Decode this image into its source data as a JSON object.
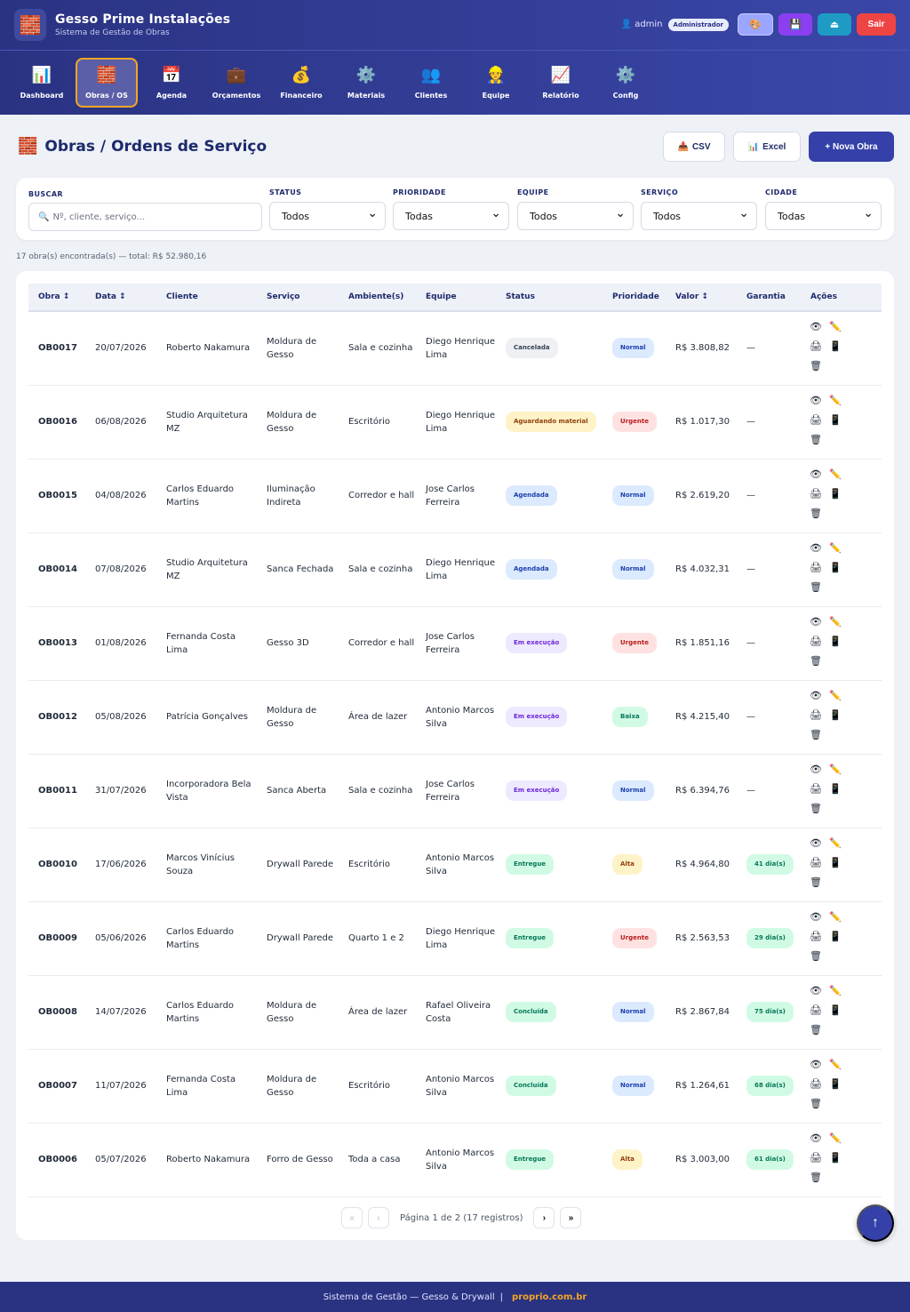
{
  "app": {
    "title": "Gesso Prime Instalações",
    "subtitle": "Sistema de Gestão de Obras",
    "logo_icon": "brick-icon"
  },
  "user": {
    "name": "admin",
    "role": "Administrador"
  },
  "header_buttons": [
    {
      "icon": "palette-icon",
      "glyph": "🎨"
    },
    {
      "icon": "save-icon",
      "glyph": "💾"
    },
    {
      "icon": "upload-icon",
      "glyph": "⏏"
    },
    {
      "label": "Sair"
    }
  ],
  "nav": [
    {
      "label": "Dashboard",
      "glyph": "📊",
      "icon": "chart-icon"
    },
    {
      "label": "Obras / OS",
      "glyph": "🧱",
      "icon": "brick-icon",
      "active": true
    },
    {
      "label": "Agenda",
      "glyph": "📅",
      "icon": "calendar-icon"
    },
    {
      "label": "Orçamentos",
      "glyph": "💼",
      "icon": "briefcase-icon"
    },
    {
      "label": "Financeiro",
      "glyph": "💰",
      "icon": "money-bag-icon"
    },
    {
      "label": "Materiais",
      "glyph": "⚙️",
      "icon": "gear-icon"
    },
    {
      "label": "Clientes",
      "glyph": "👥",
      "icon": "people-icon"
    },
    {
      "label": "Equipe",
      "glyph": "👷",
      "icon": "worker-icon"
    },
    {
      "label": "Relatório",
      "glyph": "📈",
      "icon": "trend-chart-icon"
    },
    {
      "label": "Config",
      "glyph": "⚙️",
      "icon": "gear-icon"
    }
  ],
  "page": {
    "title": "Obras / Ordens de Serviço",
    "icon": "brick-icon",
    "csv_label": "CSV",
    "excel_label": "Excel",
    "new_label": "+ Nova Obra"
  },
  "filters": {
    "search_label": "BUSCAR",
    "search_placeholder": "Nº, cliente, serviço...",
    "selects": [
      {
        "label": "STATUS",
        "value": "Todos"
      },
      {
        "label": "PRIORIDADE",
        "value": "Todas"
      },
      {
        "label": "EQUIPE",
        "value": "Todos"
      },
      {
        "label": "SERVIÇO",
        "value": "Todos"
      },
      {
        "label": "CIDADE",
        "value": "Todas"
      }
    ]
  },
  "summary": "17 obra(s) encontrada(s) — total: R$ 52.980,16",
  "table": {
    "headers": [
      "Obra ↕",
      "Data ↕",
      "Cliente",
      "Serviço",
      "Ambiente(s)",
      "Equipe",
      "Status",
      "Prioridade",
      "Valor ↕",
      "Garantia",
      "Ações"
    ],
    "rows": [
      {
        "obra": "OB0017",
        "data": "20/07/2026",
        "cliente": "Roberto Nakamura",
        "servico": "Moldura de Gesso",
        "ambiente": "Sala e cozinha",
        "equipe": "Diego Henrique Lima",
        "status": "Cancelada",
        "status_class": "st-cancelada",
        "prioridade": "Normal",
        "prio_class": "pr-normal",
        "valor": "R$ 3.808,82",
        "garantia": "—"
      },
      {
        "obra": "OB0016",
        "data": "06/08/2026",
        "cliente": "Studio Arquitetura MZ",
        "servico": "Moldura de Gesso",
        "ambiente": "Escritório",
        "equipe": "Diego Henrique Lima",
        "status": "Aguardando material",
        "status_class": "st-aguardando",
        "prioridade": "Urgente",
        "prio_class": "pr-urgente",
        "valor": "R$ 1.017,30",
        "garantia": "—"
      },
      {
        "obra": "OB0015",
        "data": "04/08/2026",
        "cliente": "Carlos Eduardo Martins",
        "servico": "Iluminação Indireta",
        "ambiente": "Corredor e hall",
        "equipe": "Jose Carlos Ferreira",
        "status": "Agendada",
        "status_class": "st-agendada",
        "prioridade": "Normal",
        "prio_class": "pr-normal",
        "valor": "R$ 2.619,20",
        "garantia": "—"
      },
      {
        "obra": "OB0014",
        "data": "07/08/2026",
        "cliente": "Studio Arquitetura MZ",
        "servico": "Sanca Fechada",
        "ambiente": "Sala e cozinha",
        "equipe": "Diego Henrique Lima",
        "status": "Agendada",
        "status_class": "st-agendada",
        "prioridade": "Normal",
        "prio_class": "pr-normal",
        "valor": "R$ 4.032,31",
        "garantia": "—"
      },
      {
        "obra": "OB0013",
        "data": "01/08/2026",
        "cliente": "Fernanda Costa Lima",
        "servico": "Gesso 3D",
        "ambiente": "Corredor e hall",
        "equipe": "Jose Carlos Ferreira",
        "status": "Em execução",
        "status_class": "st-execucao",
        "prioridade": "Urgente",
        "prio_class": "pr-urgente",
        "valor": "R$ 1.851,16",
        "garantia": "—"
      },
      {
        "obra": "OB0012",
        "data": "05/08/2026",
        "cliente": "Patrícia Gonçalves",
        "servico": "Moldura de Gesso",
        "ambiente": "Área de lazer",
        "equipe": "Antonio Marcos Silva",
        "status": "Em execução",
        "status_class": "st-execucao",
        "prioridade": "Baixa",
        "prio_class": "pr-baixa",
        "valor": "R$ 4.215,40",
        "garantia": "—"
      },
      {
        "obra": "OB0011",
        "data": "31/07/2026",
        "cliente": "Incorporadora Bela Vista",
        "servico": "Sanca Aberta",
        "ambiente": "Sala e cozinha",
        "equipe": "Jose Carlos Ferreira",
        "status": "Em execução",
        "status_class": "st-execucao",
        "prioridade": "Normal",
        "prio_class": "pr-normal",
        "valor": "R$ 6.394,76",
        "garantia": "—"
      },
      {
        "obra": "OB0010",
        "data": "17/06/2026",
        "cliente": "Marcos Vinícius Souza",
        "servico": "Drywall Parede",
        "ambiente": "Escritório",
        "equipe": "Antonio Marcos Silva",
        "status": "Entregue",
        "status_class": "st-entregue",
        "prioridade": "Alta",
        "prio_class": "pr-alta",
        "valor": "R$ 4.964,80",
        "garantia": "41 dia(s)"
      },
      {
        "obra": "OB0009",
        "data": "05/06/2026",
        "cliente": "Carlos Eduardo Martins",
        "servico": "Drywall Parede",
        "ambiente": "Quarto 1 e 2",
        "equipe": "Diego Henrique Lima",
        "status": "Entregue",
        "status_class": "st-entregue",
        "prioridade": "Urgente",
        "prio_class": "pr-urgente",
        "valor": "R$ 2.563,53",
        "garantia": "29 dia(s)"
      },
      {
        "obra": "OB0008",
        "data": "14/07/2026",
        "cliente": "Carlos Eduardo Martins",
        "servico": "Moldura de Gesso",
        "ambiente": "Área de lazer",
        "equipe": "Rafael Oliveira Costa",
        "status": "Concluída",
        "status_class": "st-concluida",
        "prioridade": "Normal",
        "prio_class": "pr-normal",
        "valor": "R$ 2.867,84",
        "garantia": "75 dia(s)"
      },
      {
        "obra": "OB0007",
        "data": "11/07/2026",
        "cliente": "Fernanda Costa Lima",
        "servico": "Moldura de Gesso",
        "ambiente": "Escritório",
        "equipe": "Antonio Marcos Silva",
        "status": "Concluída",
        "status_class": "st-concluida",
        "prioridade": "Normal",
        "prio_class": "pr-normal",
        "valor": "R$ 1.264,61",
        "garantia": "68 dia(s)"
      },
      {
        "obra": "OB0006",
        "data": "05/07/2026",
        "cliente": "Roberto Nakamura",
        "servico": "Forro de Gesso",
        "ambiente": "Toda a casa",
        "equipe": "Antonio Marcos Silva",
        "status": "Entregue",
        "status_class": "st-entregue",
        "prioridade": "Alta",
        "prio_class": "pr-alta",
        "valor": "R$ 3.003,00",
        "garantia": "61 dia(s)"
      }
    ],
    "row_actions": [
      {
        "icon": "eye-icon",
        "glyph": "👁"
      },
      {
        "icon": "pencil-icon",
        "glyph": "✏️"
      },
      {
        "icon": "printer-icon",
        "glyph": "🖨"
      },
      {
        "icon": "phone-icon",
        "glyph": "📱"
      },
      {
        "icon": "trash-icon",
        "glyph": "🗑"
      }
    ]
  },
  "pagination": {
    "first": "«",
    "prev": "‹",
    "info": "Página 1 de 2 (17 registros)",
    "next": "›",
    "last": "»"
  },
  "fab_glyph": "↑",
  "footer": {
    "text": "Sistema de Gestão — Gesso & Drywall",
    "separator": "|",
    "link": "proprio.com.br"
  }
}
